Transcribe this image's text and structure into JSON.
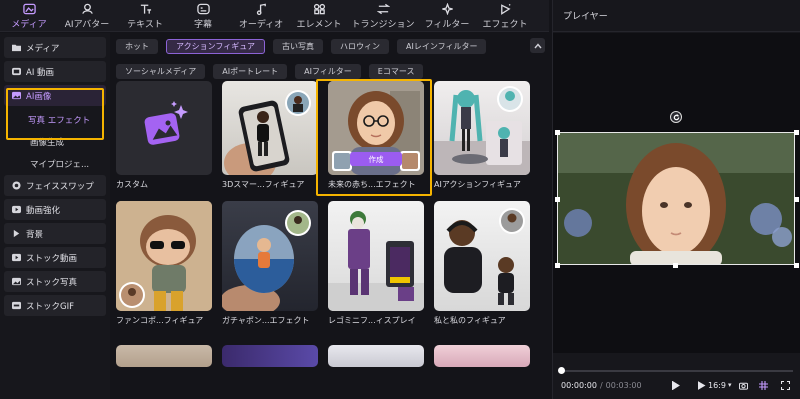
{
  "toolbar": {
    "tabs": [
      {
        "label": "メディア",
        "icon": "media-icon"
      },
      {
        "label": "AIアバター",
        "icon": "avatar-icon"
      },
      {
        "label": "テキスト",
        "icon": "text-icon"
      },
      {
        "label": "字幕",
        "icon": "caption-icon"
      },
      {
        "label": "オーディオ",
        "icon": "audio-icon"
      },
      {
        "label": "エレメント",
        "icon": "element-icon"
      },
      {
        "label": "トランジション",
        "icon": "transition-icon"
      },
      {
        "label": "フィルター",
        "icon": "filter-icon"
      },
      {
        "label": "エフェクト",
        "icon": "effect-icon"
      }
    ],
    "active_index": 0
  },
  "sidebar": {
    "items": [
      {
        "label": "メディア"
      },
      {
        "label": "AI 動画"
      },
      {
        "label": "AI画像"
      },
      {
        "label": "フェイススワップ"
      },
      {
        "label": "動画強化"
      },
      {
        "label": "背景"
      },
      {
        "label": "ストック動画"
      },
      {
        "label": "ストック写真"
      },
      {
        "label": "ストックGIF"
      }
    ],
    "sub_items": [
      {
        "label": "写真 エフェクト"
      },
      {
        "label": "画像生成"
      },
      {
        "label": "マイプロジェ..."
      }
    ]
  },
  "chips": {
    "row1": [
      "ホット",
      "アクションフィギュア",
      "古い写真",
      "ハロウィン",
      "AIレインフィルター"
    ],
    "row2": [
      "ソーシャルメディア",
      "AIポートレート",
      "AIフィルター",
      "Eコマース"
    ],
    "active": "アクションフィギュア"
  },
  "cards": [
    {
      "label": "カスタム"
    },
    {
      "label": "3Dスマー...フィギュア"
    },
    {
      "label": "未来の赤ち...エフェクト"
    },
    {
      "label": "AIアクションフィギュア"
    },
    {
      "label": "ファンコポ...フィギュア"
    },
    {
      "label": "ガチャポン...エフェクト"
    },
    {
      "label": "レゴミニフ...ィスプレイ"
    },
    {
      "label": "私と私のフィギュア"
    }
  ],
  "create_button": "作成",
  "player": {
    "title": "プレイヤー",
    "current_time": "00:00:00",
    "separator": "/",
    "total_time": "00:03:00",
    "aspect": "16:9"
  },
  "colors": {
    "accent": "#c59bff",
    "highlight": "#f5b400",
    "button": "#9b5cf0"
  }
}
